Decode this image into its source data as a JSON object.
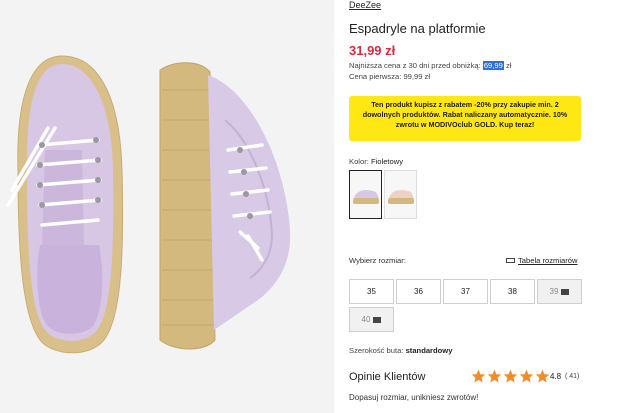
{
  "product": {
    "brand": "DeeZee",
    "title": "Espadryle na platformie",
    "price": "31,99 zł",
    "lowest_price_label": "Najniższa cena z 30 dni przed obniżką:",
    "lowest_price_value": "69,99",
    "lowest_price_currency": "zł",
    "first_price": "Cena pierwsza: 99,99 zł"
  },
  "promo": {
    "text": "Ten produkt kupisz z rabatem -20% przy zakupie min. 2 dowolnych produktów. Rabat naliczany automatycznie. 10% zwrotu w MODIVOclub GOLD. Kup teraz!"
  },
  "color": {
    "label": "Kolor:",
    "value": "Fioletowy",
    "swatches": [
      {
        "name": "Fioletowy",
        "color": "#d8c8e6"
      },
      {
        "name": "Beżowy",
        "color": "#efd2c6"
      }
    ]
  },
  "sizes": {
    "label": "Wybierz rozmiar:",
    "table_link": "Tabela rozmiarów",
    "options": [
      {
        "label": "35",
        "available": true
      },
      {
        "label": "36",
        "available": true
      },
      {
        "label": "37",
        "available": true
      },
      {
        "label": "38",
        "available": true
      },
      {
        "label": "39",
        "available": false
      },
      {
        "label": "40",
        "available": false
      }
    ]
  },
  "shoe_width": {
    "label": "Szerokość buta:",
    "value": "standardowy"
  },
  "reviews": {
    "title": "Opinie Klientów",
    "rating": "4.8",
    "count": "( 41)",
    "star_color": "#f28c28",
    "subtitle": "Dopasuj rozmiar, unikniesz zwrotów!"
  }
}
